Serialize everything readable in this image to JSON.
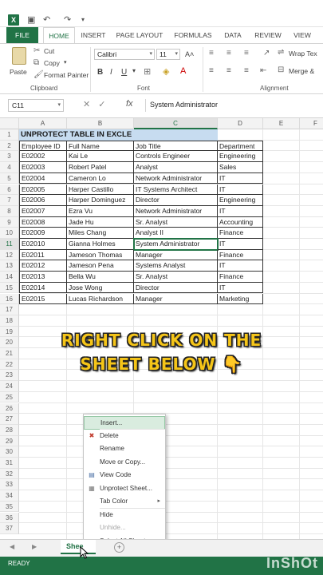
{
  "ribbon": {
    "tabs": [
      "FILE",
      "HOME",
      "INSERT",
      "PAGE LAYOUT",
      "FORMULAS",
      "DATA",
      "REVIEW",
      "VIEW"
    ],
    "clipboard": {
      "paste": "Paste",
      "cut": "Cut",
      "copy": "Copy",
      "format_painter": "Format Painter",
      "label": "Clipboard"
    },
    "font": {
      "name": "Calibri",
      "size": "11",
      "label": "Font"
    },
    "alignment": {
      "wrap": "Wrap Tex",
      "merge": "Merge &",
      "label": "Alignment"
    }
  },
  "formula_bar": {
    "name_box": "C11",
    "fx": "fx",
    "content": "System Administrator"
  },
  "columns": [
    "A",
    "B",
    "C",
    "D",
    "E",
    "F"
  ],
  "rows": [
    "1",
    "2",
    "3",
    "4",
    "5",
    "6",
    "7",
    "8",
    "9",
    "10",
    "11",
    "12",
    "13",
    "14",
    "15",
    "16",
    "17",
    "18",
    "19",
    "20",
    "21",
    "22",
    "23",
    "24",
    "25",
    "26",
    "27",
    "28",
    "29",
    "30",
    "31",
    "32",
    "33",
    "34",
    "35",
    "36",
    "37"
  ],
  "sheet": {
    "title": "UNPROTECT TABLE IN EXCLE",
    "headers": [
      "Employee ID",
      "Full Name",
      "Job Title",
      "Department"
    ],
    "records": [
      [
        "E02002",
        "Kai Le",
        "Controls Engineer",
        "Engineering"
      ],
      [
        "E02003",
        "Robert Patel",
        "Analyst",
        "Sales"
      ],
      [
        "E02004",
        "Cameron Lo",
        "Network Administrator",
        "IT"
      ],
      [
        "E02005",
        "Harper Castillo",
        "IT Systems Architect",
        "IT"
      ],
      [
        "E02006",
        "Harper Dominguez",
        "Director",
        "Engineering"
      ],
      [
        "E02007",
        "Ezra Vu",
        "Network Administrator",
        "IT"
      ],
      [
        "E02008",
        "Jade Hu",
        "Sr. Analyst",
        "Accounting"
      ],
      [
        "E02009",
        "Miles Chang",
        "Analyst II",
        "Finance"
      ],
      [
        "E02010",
        "Gianna Holmes",
        "System Administrator",
        "IT"
      ],
      [
        "E02011",
        "Jameson Thomas",
        "Manager",
        "Finance"
      ],
      [
        "E02012",
        "Jameson Pena",
        "Systems Analyst",
        "IT"
      ],
      [
        "E02013",
        "Bella Wu",
        "Sr. Analyst",
        "Finance"
      ],
      [
        "E02014",
        "Jose Wong",
        "Director",
        "IT"
      ],
      [
        "E02015",
        "Lucas Richardson",
        "Manager",
        "Marketing"
      ]
    ]
  },
  "caption": {
    "line1": "RIGHT CLICK ON THE",
    "line2": "SHEET BELOW 👇"
  },
  "context_menu": {
    "items": [
      {
        "label": "Insert...",
        "icon": "",
        "state": "hover"
      },
      {
        "label": "Delete",
        "icon": "delete-sheet-icon",
        "state": "normal"
      },
      {
        "label": "Rename",
        "icon": "",
        "state": "normal"
      },
      {
        "label": "Move or Copy...",
        "icon": "",
        "state": "normal"
      },
      {
        "label": "View Code",
        "icon": "view-code-icon",
        "state": "normal"
      },
      {
        "label": "Unprotect Sheet...",
        "icon": "protect-sheet-icon",
        "state": "normal"
      },
      {
        "label": "Tab Color",
        "icon": "",
        "state": "submenu"
      },
      {
        "label": "Hide",
        "icon": "",
        "state": "normal"
      },
      {
        "label": "Unhide...",
        "icon": "",
        "state": "disabled"
      },
      {
        "label": "Select All Sheets",
        "icon": "",
        "state": "normal"
      }
    ]
  },
  "sheet_tabs": {
    "active": "Shee",
    "add": "+"
  },
  "status": {
    "text": "READY",
    "watermark": "InShOt"
  },
  "colors": {
    "accent": "#217346",
    "title_fill": "#c7dcf0",
    "caption": "#f5c518"
  }
}
